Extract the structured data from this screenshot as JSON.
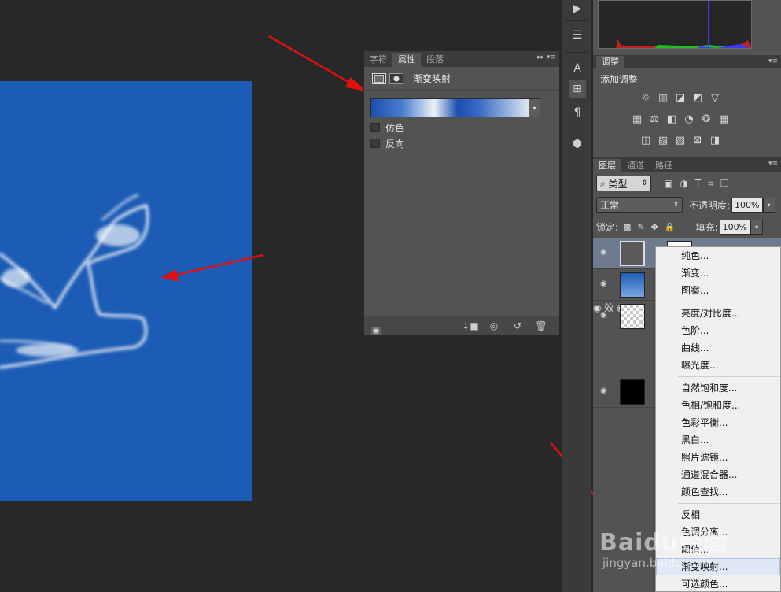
{
  "properties_panel": {
    "tabs": [
      "字符",
      "属性",
      "段落"
    ],
    "active_tab": "属性",
    "title": "渐变映射",
    "options": [
      {
        "label": "仿色",
        "checked": false
      },
      {
        "label": "反向",
        "checked": false
      }
    ],
    "gradient": {
      "colors": [
        "#1a4fb0",
        "#eef2f8",
        "#1a4fb0",
        "#dfe6f2"
      ]
    }
  },
  "adjustments_panel": {
    "tab": "调整",
    "title": "添加调整",
    "icon_rows": [
      [
        "brightness-icon",
        "levels-icon",
        "curves-icon",
        "exposure-icon",
        "triangle-icon"
      ],
      [
        "vibrance-icon",
        "balance-icon",
        "bw-icon",
        "photo-filter-icon",
        "channel-mixer-icon",
        "grid-icon"
      ],
      [
        "invert-icon",
        "posterize-icon",
        "threshold-icon",
        "gradient-map-icon",
        "selective-color-icon"
      ]
    ]
  },
  "layers_panel": {
    "tabs": [
      "图层",
      "通道",
      "路径"
    ],
    "active_tab": "图层",
    "filter_kind": "类型",
    "blend_mode": "正常",
    "opacity_label": "不透明度:",
    "opacity_value": "100%",
    "lock_label": "锁定:",
    "fill_label": "填充:",
    "fill_value": "100%",
    "layers": [
      {
        "kind": "adjustment",
        "selected": true
      },
      {
        "kind": "cloud-image"
      },
      {
        "kind": "transparent",
        "effects_label": "效"
      },
      {
        "kind": "black"
      }
    ]
  },
  "context_menu": {
    "groups": [
      [
        "纯色...",
        "渐变...",
        "图案..."
      ],
      [
        "亮度/对比度...",
        "色阶...",
        "曲线...",
        "曝光度..."
      ],
      [
        "自然饱和度...",
        "色相/饱和度...",
        "色彩平衡...",
        "黑白...",
        "照片滤镜...",
        "通道混合器...",
        "颜色查找..."
      ],
      [
        "反相",
        "色调分离...",
        "阈值...",
        "渐变映射...",
        "可选颜色..."
      ]
    ],
    "highlighted": "渐变映射..."
  },
  "watermark": {
    "brand": "Baidu经验",
    "url": "jingyan.baidu.com"
  },
  "colors": {
    "canvas_blue": "#1d5cb5",
    "arrow_red": "#e01010",
    "panel_bg": "#535353",
    "app_bg": "#282828"
  }
}
